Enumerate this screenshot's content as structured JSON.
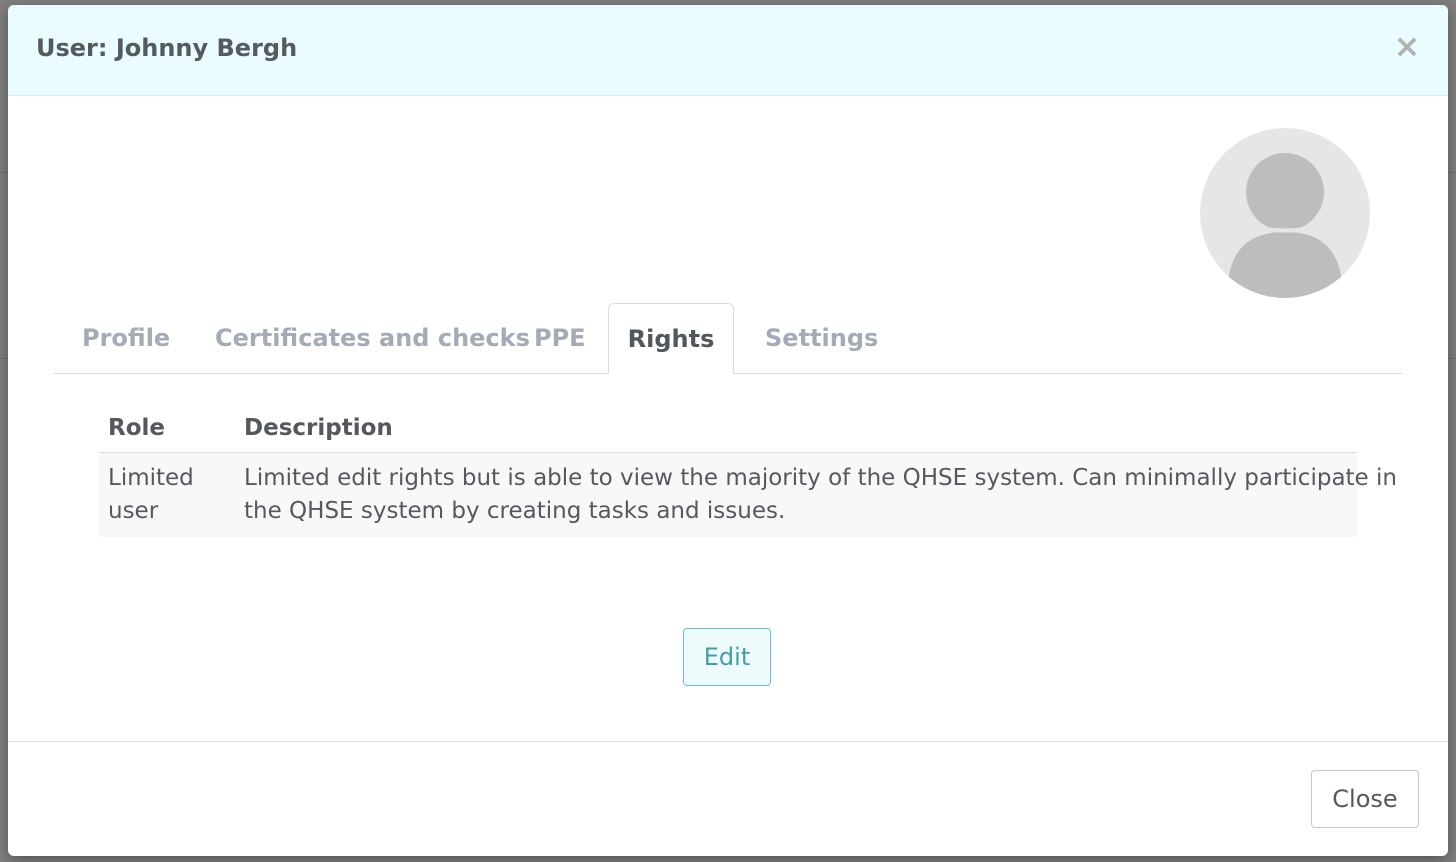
{
  "modal": {
    "title": "User: Johnny Bergh",
    "close_icon": "×"
  },
  "avatar": {
    "icon": "user-avatar-placeholder"
  },
  "tabs": [
    {
      "label": "Profile",
      "active": false
    },
    {
      "label": "Certificates and checks",
      "active": false
    },
    {
      "label": "PPE",
      "active": false
    },
    {
      "label": "Rights",
      "active": true
    },
    {
      "label": "Settings",
      "active": false
    }
  ],
  "rights_table": {
    "headers": {
      "role": "Role",
      "description": "Description"
    },
    "rows": [
      {
        "role_line1": "Limited",
        "role_line2": "user",
        "description_line1": "Limited edit rights but is able to view the majority of the QHSE system. Can minimally participate in",
        "description_line2": "the QHSE system by creating tasks and issues."
      }
    ]
  },
  "buttons": {
    "edit_label": "Edit",
    "close_label": "Close"
  },
  "colors": {
    "header_bg": "#eafcfd",
    "accent": "#3f9fa8",
    "muted_tab": "#a4abb6"
  }
}
